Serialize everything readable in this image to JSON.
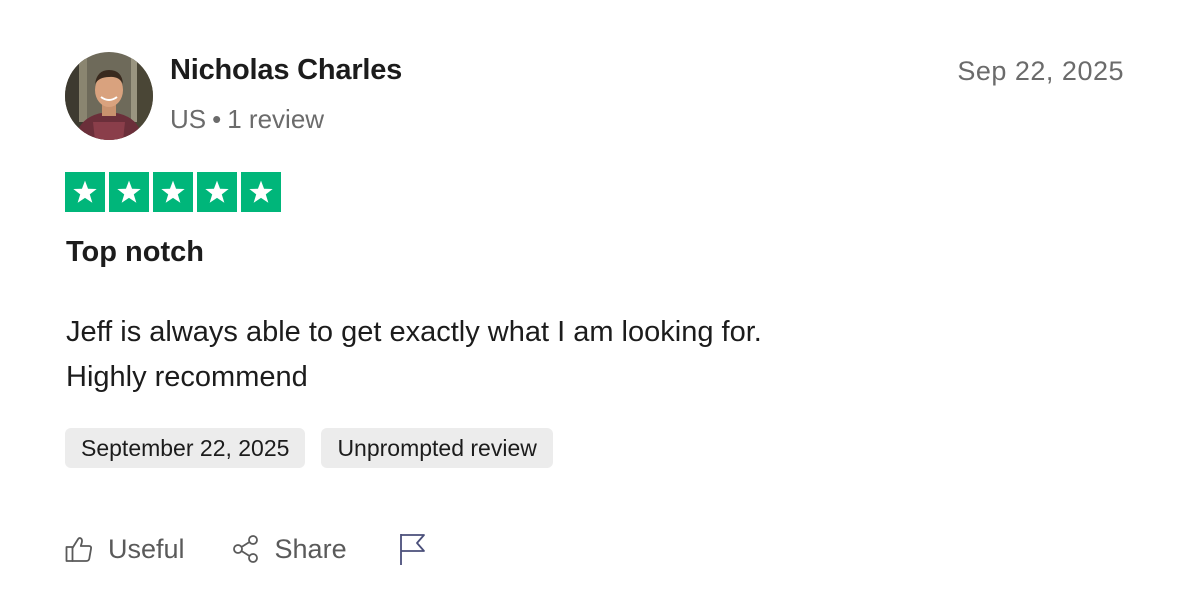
{
  "reviewer": {
    "name": "Nicholas Charles",
    "country": "US",
    "separator": "•",
    "review_count": "1 review"
  },
  "review": {
    "date_short": "Sep 22, 2025",
    "rating": 5,
    "rating_max": 5,
    "title": "Top notch",
    "body_lines": [
      "Jeff is always able to get exactly what I am looking for.",
      "Highly recommend"
    ],
    "tags": [
      "September 22, 2025",
      "Unprompted review"
    ]
  },
  "actions": {
    "useful_label": "Useful",
    "share_label": "Share",
    "useful_icon": "thumbs-up-icon",
    "share_icon": "share-icon",
    "report_icon": "flag-icon"
  },
  "colors": {
    "star_green": "#00b67a",
    "tag_bg": "#ececec",
    "muted_text": "#6b6b6b"
  }
}
